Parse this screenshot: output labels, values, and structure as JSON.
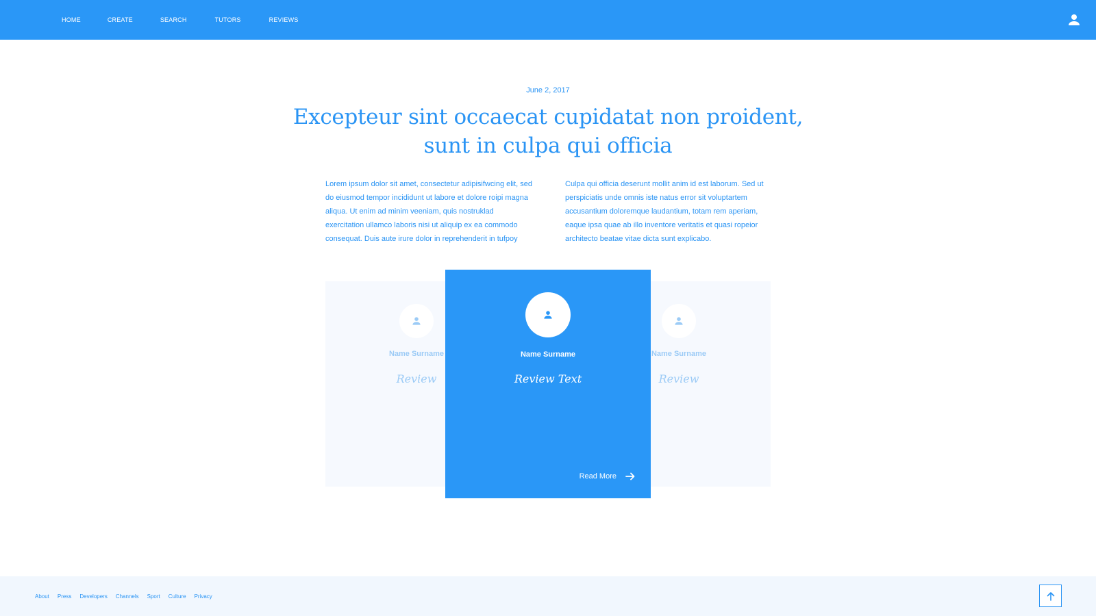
{
  "nav": {
    "items": [
      {
        "label": "HOME"
      },
      {
        "label": "CREATE"
      },
      {
        "label": "SEARCH"
      },
      {
        "label": "TUTORS"
      },
      {
        "label": "REVIEWS"
      }
    ],
    "user_icon": "user-icon"
  },
  "article": {
    "date": "June 2, 2017",
    "headline": "Excepteur sint occaecat cupidatat non proident, sunt in culpa qui officia",
    "col_left": "Lorem ipsum dolor sit amet, consectetur adipisifwcing elit, sed do eiusmod tempor incididunt ut labore et dolore roipi magna aliqua. Ut enim ad minim veeniam, quis nostruklad exercitation ullamco laboris nisi ut aliquip ex ea commodo consequat. Duis aute irure dolor in reprehenderit in tufpoy",
    "col_right": "Culpa qui officia deserunt mollit anim id est laborum. Sed ut perspiciatis unde omnis iste natus error sit voluptartem accusantium doloremque laudantium, totam rem aperiam, eaque ipsa quae ab illo inventore veritatis et quasi ropeior architecto beatae vitae dicta sunt explicabo."
  },
  "reviews": {
    "left": {
      "name": "Name Surname",
      "text": "Review"
    },
    "center": {
      "name": "Name Surname",
      "text": "Review Text",
      "read_more": "Read More"
    },
    "right": {
      "name": "Name Surname",
      "text": "Review"
    }
  },
  "footer": {
    "links": [
      "About",
      "Press",
      "Developers",
      "Channels",
      "Sport",
      "Culture",
      "Privacy"
    ],
    "to_top_icon": "arrow-up-icon"
  },
  "colors": {
    "primary": "#2a97f7",
    "text_blue": "#2a94f4",
    "muted_blue": "#9ccbf6",
    "band_bg": "#f6f9fe",
    "footer_bg": "#f1f7fe"
  }
}
